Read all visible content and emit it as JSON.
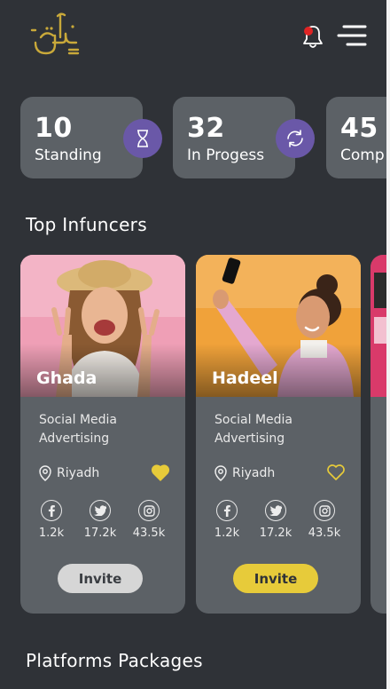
{
  "header": {
    "logo_text": "أرّكيو",
    "logo_icon": "brand-logo",
    "notification_icon": "bell-icon",
    "menu_icon": "hamburger-menu-icon"
  },
  "stats": [
    {
      "value": "10",
      "label": "Standing",
      "icon": "hourglass-icon"
    },
    {
      "value": "32",
      "label": "In Progess",
      "icon": "sync-icon"
    },
    {
      "value": "45",
      "label": "Comp"
    }
  ],
  "sections": {
    "top_influencers": "Top Infuncers",
    "platforms_packages": "Platforms Packages"
  },
  "influencers": [
    {
      "name": "Ghada",
      "category_line1": "Social Media",
      "category_line2": "Advertising",
      "location": "Riyadh",
      "favorited": true,
      "facebook": "1.2k",
      "twitter": "17.2k",
      "instagram": "43.5k",
      "invite_label": "Invite"
    },
    {
      "name": "Hadeel",
      "category_line1": "Social Media",
      "category_line2": "Advertising",
      "location": "Riyadh",
      "favorited": false,
      "facebook": "1.2k",
      "twitter": "17.2k",
      "instagram": "43.5k",
      "invite_label": "Invite"
    }
  ],
  "colors": {
    "background": "#2f3237",
    "card": "#5c6166",
    "accent_purple": "#6a58a8",
    "accent_yellow": "#e7cb3a",
    "notification_dot": "#e02424",
    "logo_gold": "#c9a93a"
  }
}
